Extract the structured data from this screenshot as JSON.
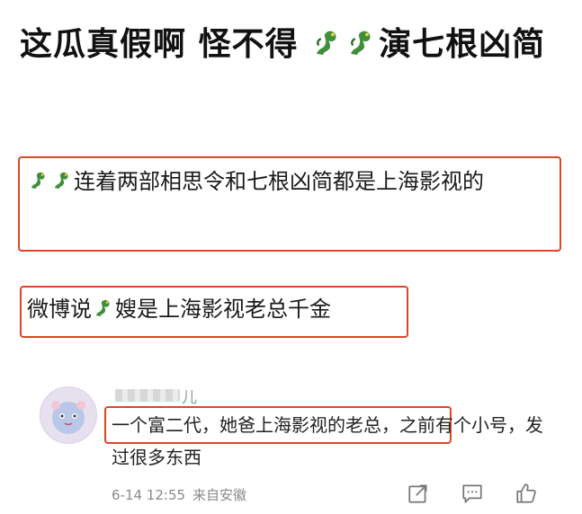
{
  "post": {
    "title_part1": "这瓜真假啊 怪不得",
    "title_part2": "演七根凶简"
  },
  "highlights": {
    "para1_text": "连着两部相思令和七根凶简都是上海影视的",
    "para2_prefix": "微博说",
    "para2_suffix": "嫂是上海影视老总千金"
  },
  "comment": {
    "username_visible": "儿",
    "text_highlighted": "一个富二代，她爸上海影视的老总，",
    "text_rest": "之前有个小号，发过很多东西",
    "date": "6-14 12:55",
    "source": "来自安徽"
  },
  "icons": {
    "dragon": "dragon-emoji",
    "share": "share-icon",
    "comment": "comment-icon",
    "like": "thumbs-up-icon"
  },
  "colors": {
    "highlight_border": "#d9472b",
    "dragon_green": "#3f8f3a"
  }
}
